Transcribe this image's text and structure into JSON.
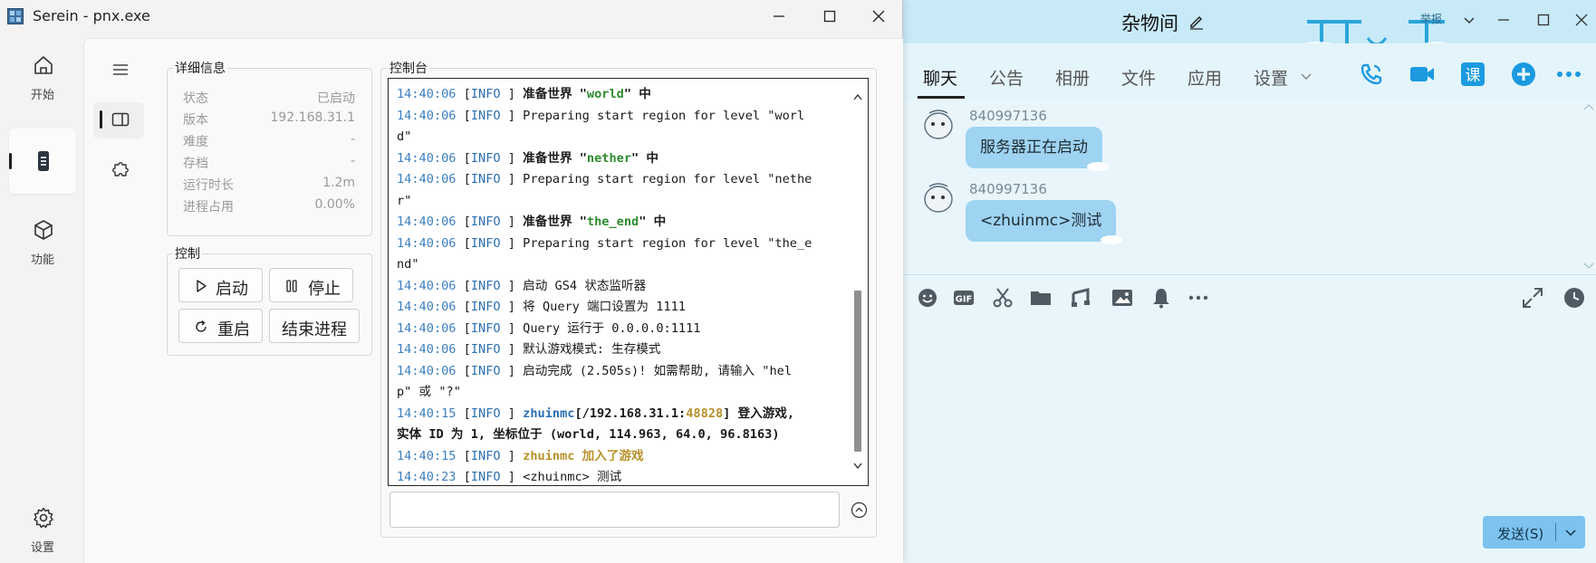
{
  "serein": {
    "title": "Serein - pnx.exe",
    "nav": [
      {
        "label": "开始",
        "icon": "home-icon"
      },
      {
        "label": "",
        "icon": "server-icon",
        "active": true
      },
      {
        "label": "功能",
        "icon": "cube-icon"
      },
      {
        "label": "设置",
        "icon": "gear-icon"
      }
    ],
    "details": {
      "legend": "详细信息",
      "rows": [
        {
          "key": "状态",
          "value": "已启动"
        },
        {
          "key": "版本",
          "value": "192.168.31.1"
        },
        {
          "key": "难度",
          "value": "-"
        },
        {
          "key": "存档",
          "value": "-"
        },
        {
          "key": "运行时长",
          "value": "1.2m"
        },
        {
          "key": "进程占用",
          "value": "0.00%"
        }
      ]
    },
    "control": {
      "legend": "控制",
      "start": "启动",
      "stop": "停止",
      "restart": "重启",
      "kill": "结束进程"
    },
    "console": {
      "legend": "控制台",
      "time1": "14:40:06",
      "time2": "14:40:15",
      "time3": "14:40:23",
      "level": "INFO",
      "prepare_world_pre": "准备世界 \"",
      "prepare_world_post": "\" 中",
      "world": "world",
      "nether": "nether",
      "the_end": "the_end",
      "region_world_a": "Preparing start region for level \"worl",
      "region_world_b": "d\"",
      "region_nether_a": "Preparing start region for level \"nethe",
      "region_nether_b": "r\"",
      "region_end_a": "Preparing start region for level \"the_e",
      "region_end_b": "nd\"",
      "gs4": "启动 GS4 状态监听器",
      "query_port": "将 Query 端口设置为 1111",
      "query_run": "Query 运行于 0.0.0.0:1111",
      "gamemode": "默认游戏模式: 生存模式",
      "done_a": "启动完成 (2.505s)! 如需帮助, 请输入 \"hel",
      "done_b": "p\" 或 \"?\"",
      "player": "zhuinmc",
      "ip": "/192.168.31.1:",
      "port": "48828",
      "login_a": "] 登入游戏,",
      "login_b": "实体 ID 为 1, 坐标位于 (world, 114.963, 64.0, 96.8163)",
      "joined": "加入了游戏",
      "chat": "<zhuinmc> 测试"
    }
  },
  "chat": {
    "title": "杂物间",
    "report": "举报",
    "tabs": [
      "聊天",
      "公告",
      "相册",
      "文件",
      "应用",
      "设置"
    ],
    "messages": [
      {
        "sender": "840997136",
        "text": "服务器正在启动"
      },
      {
        "sender": "840997136",
        "text": "<zhuinmc>测试"
      }
    ],
    "send": "发送(S)"
  }
}
